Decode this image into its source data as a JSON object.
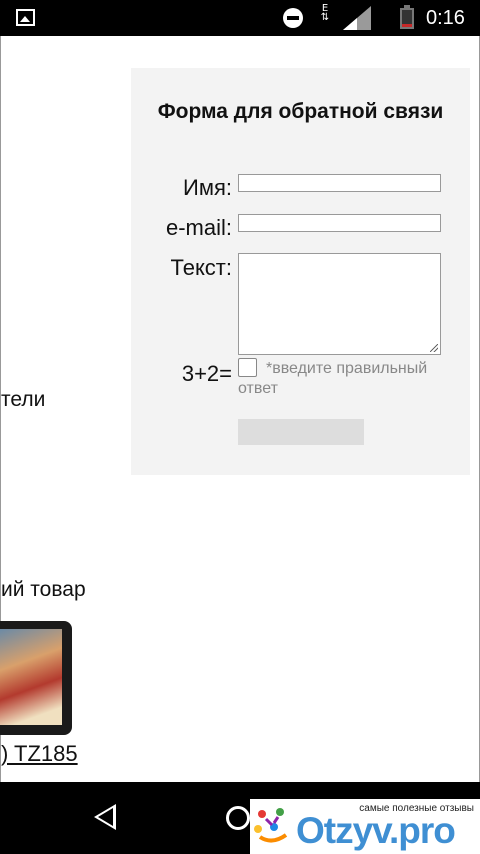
{
  "status_bar": {
    "time": "0:16",
    "network_label": "E",
    "icons": [
      "image-notification-icon",
      "do-not-disturb-icon",
      "mobile-data-icon",
      "signal-icon",
      "battery-icon"
    ]
  },
  "background_page": {
    "fragment_1": "тели",
    "fragment_2": "ий товар",
    "product_link": ") TZ185"
  },
  "feedback_form": {
    "title": "Форма для обратной связи",
    "name_label": "Имя:",
    "name_value": "",
    "email_label": "e-mail:",
    "email_value": "",
    "text_label": "Текст:",
    "text_value": "",
    "captcha_label": "3+2=",
    "captcha_hint": "*введите правильный ответ",
    "submit_label": "",
    "colors": {
      "panel_bg": "#f3f3f3",
      "button_bg": "#dddddd",
      "hint": "#888888"
    }
  },
  "nav_bar": {
    "icons": [
      "back-icon",
      "home-icon"
    ]
  },
  "watermark": {
    "tagline": "самые полезные отзывы",
    "logo_text": "Otzyv.pro",
    "brand_color": "#3f8fd3"
  }
}
